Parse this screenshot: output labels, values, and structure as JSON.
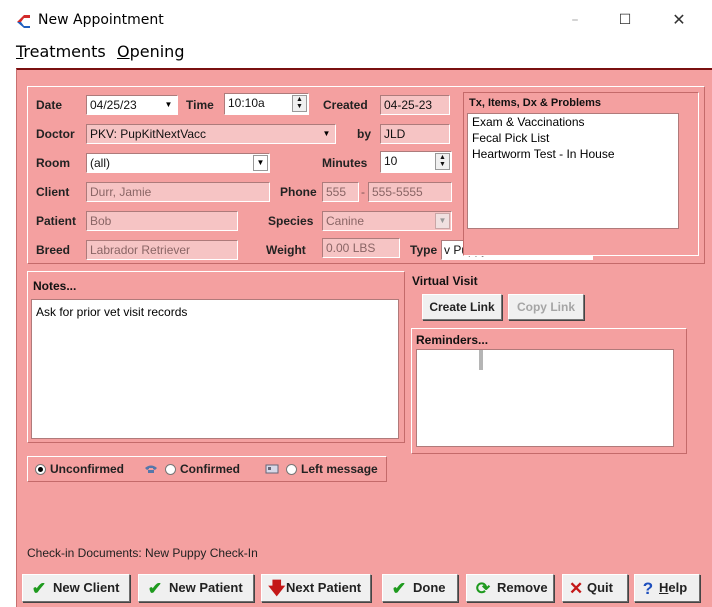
{
  "window": {
    "title": "New Appointment",
    "min": "–",
    "max": "☐",
    "close": "✕"
  },
  "menu": [
    {
      "accel": "T",
      "rest": "reatments"
    },
    {
      "accel": "O",
      "rest": "pening"
    }
  ],
  "form": {
    "date_label": "Date",
    "date": "04/25/23",
    "time_label": "Time",
    "time": "10:10a",
    "created_label": "Created",
    "created": "04-25-23",
    "doctor_label": "Doctor",
    "doctor": "PKV:  PupKitNextVacc",
    "by_label": "by",
    "by": "JLD",
    "room_label": "Room",
    "room": "(all)",
    "minutes_label": "Minutes",
    "minutes": "10",
    "client_label": "Client",
    "client": "Durr, Jamie",
    "phone_label": "Phone",
    "phone_area": "555",
    "phone_dash": "-",
    "phone_number": "555-5555",
    "patient_label": "Patient",
    "patient": "Bob",
    "species_label": "Species",
    "species": "Canine",
    "breed_label": "Breed",
    "breed": "Labrador Retriever",
    "weight_label": "Weight",
    "weight": "0.00 LBS",
    "type_label": "Type",
    "type": "v Puppy or Kitten Visit"
  },
  "tx": {
    "title": "Tx, Items, Dx & Problems",
    "items": [
      "Exam & Vaccinations",
      "Fecal Pick List",
      "Heartworm Test - In House"
    ]
  },
  "notes": {
    "title": "Notes...",
    "text": "Ask for prior vet visit records"
  },
  "virtual": {
    "title": "Virtual Visit",
    "create": "Create Link",
    "copy": "Copy Link"
  },
  "reminders": {
    "title": "Reminders..."
  },
  "status": {
    "unconfirmed": "Unconfirmed",
    "confirmed": "Confirmed",
    "left_message": "Left message",
    "selected": "Unconfirmed"
  },
  "checkin": "Check-in Documents: New Puppy Check-In",
  "buttons": {
    "new_client": "New Client",
    "new_patient": "New Patient",
    "next_patient": "Next Patient",
    "done": "Done",
    "remove": "Remove",
    "quit": "Quit",
    "help_accel": "H",
    "help_rest": "elp",
    "help_q": "?"
  },
  "colors": {
    "background": "#f4a0a0",
    "field": "#f6c4c4",
    "accent_green": "#1e9a1e",
    "accent_red": "#c41818"
  }
}
